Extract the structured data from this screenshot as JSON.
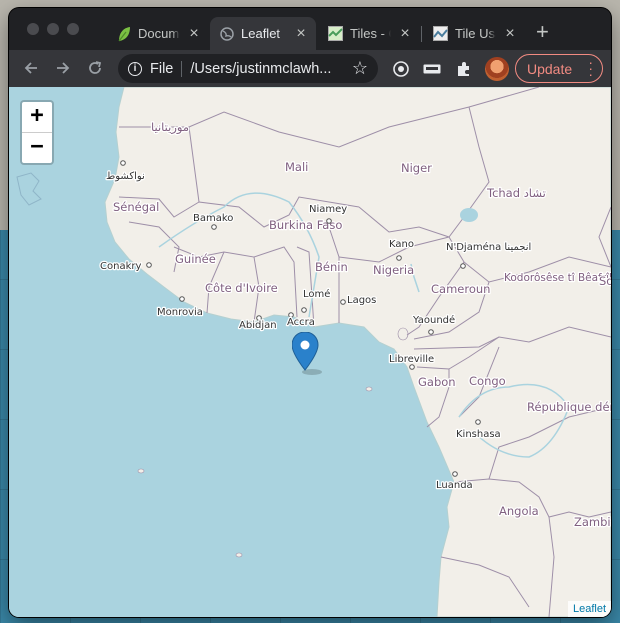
{
  "browser": {
    "tabs": [
      {
        "label": "Documentation",
        "icon": "leaf-icon",
        "active": false
      },
      {
        "label": "Leaflet",
        "icon": "globe-icon",
        "active": true
      },
      {
        "label": "Tiles - OSM",
        "icon": "map-image-icon",
        "active": false
      },
      {
        "label": "Tile Usage",
        "icon": "map-image-icon",
        "active": false
      }
    ],
    "new_tab": "+",
    "omnibox": {
      "scheme_label": "File",
      "url": "/Users/justinmclawh..."
    },
    "update_label": "Update"
  },
  "map": {
    "zoom_in": "+",
    "zoom_out": "−",
    "attribution": "Leaflet",
    "country_labels": [
      "موريتانيا",
      "Mali",
      "Niger",
      "Sénégal",
      "Tchad تشاد",
      "Burkina Faso",
      "Guinée",
      "Bénin",
      "Nigeria",
      "Côte d'Ivoire",
      "Cameroun",
      "Kodorôsêse tî Bêafrîka - République Centrafricaine",
      "Gabon",
      "Congo",
      "République démocratique du Congo",
      "Angola",
      "Zambia",
      "So"
    ],
    "city_labels": [
      "نواكشوط",
      "Bamako",
      "Niamey",
      "Kano",
      "N'Djaména انجمينا",
      "Conakry",
      "Lomé",
      "Lagos",
      "Monrovia",
      "Abidjan",
      "Accra",
      "Yaoundé",
      "Libreville",
      "Kinshasa",
      "Luanda"
    ],
    "marker": "map-marker-icon",
    "colors": {
      "water": "#aad3df",
      "land": "#f2efe9",
      "border": "#9e8fa8"
    }
  }
}
